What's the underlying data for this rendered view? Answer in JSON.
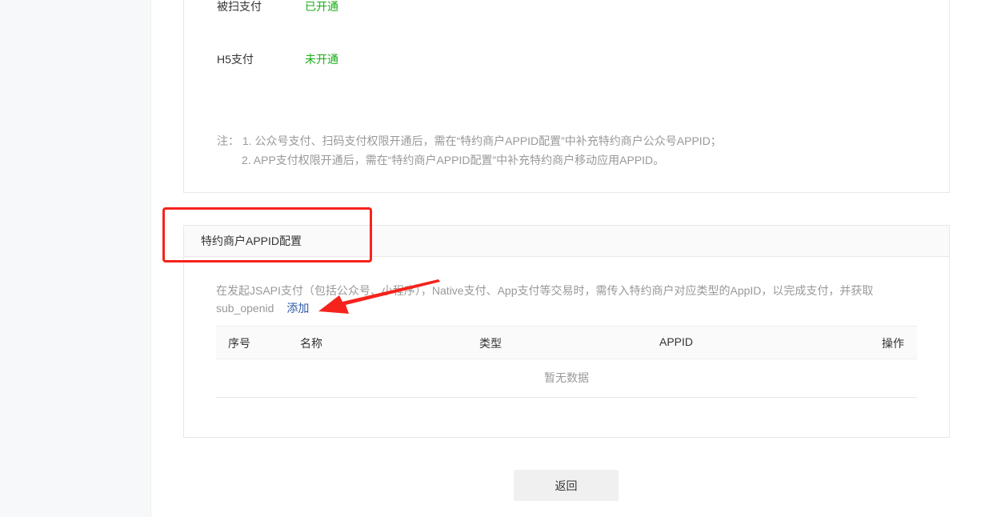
{
  "permissions": [
    {
      "name": "被扫支付",
      "status": "已开通"
    },
    {
      "name": "H5支付",
      "status": "未开通"
    }
  ],
  "status_color": "#1aad19",
  "note": {
    "line1": "注：  1. 公众号支付、扫码支付权限开通后，需在“特约商户APPID配置”中补充特约商户公众号APPID；",
    "line2": "2. APP支付权限开通后，需在“特约商户APPID配置”中补充特约商户移动应用APPID。"
  },
  "appid_section": {
    "title": "特约商户APPID配置",
    "description": "在发起JSAPI支付（包括公众号、小程序），Native支付、App支付等交易时，需传入特约商户对应类型的AppID，以完成支付，并获取sub_openid",
    "add_link": "添加",
    "columns": [
      "序号",
      "名称",
      "类型",
      "APPID",
      "操作"
    ],
    "empty_text": "暂无数据"
  },
  "back_button": "返回",
  "annotation_color": "#f5231c"
}
